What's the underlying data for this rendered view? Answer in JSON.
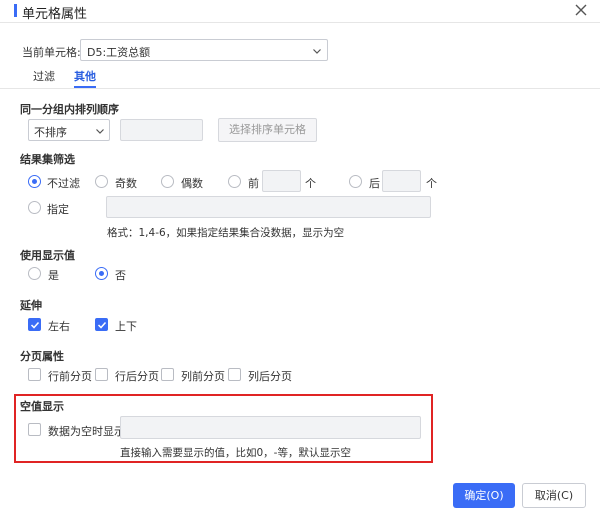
{
  "dialog": {
    "title": "单元格属性",
    "accent_color": "#3a6cf6",
    "close_icon": "close-icon"
  },
  "current_cell": {
    "label": "当前单元格:",
    "value": "D5:工资总额"
  },
  "tabs": [
    {
      "label": "过滤",
      "active": false
    },
    {
      "label": "其他",
      "active": true
    }
  ],
  "group_sort": {
    "title": "同一分组内排列顺序",
    "select_value": "不排序",
    "cell_input_value": "",
    "select_cell_button": "选择排序单元格"
  },
  "result_filter": {
    "title": "结果集筛选",
    "options": {
      "none": "不过滤",
      "odd": "奇数",
      "even": "偶数",
      "front": "前",
      "back": "后",
      "specify": "指定"
    },
    "selected": "none",
    "unit_front": "个",
    "unit_back": "个",
    "front_value": "",
    "back_value": "",
    "specify_value": "",
    "format_hint": "格式：1,4-6，如果指定结果集合没数据，显示为空"
  },
  "use_display_value": {
    "title": "使用显示值",
    "yes": "是",
    "no": "否",
    "selected": "no"
  },
  "extend": {
    "title": "延伸",
    "left_right": "左右",
    "up_down": "上下",
    "left_right_checked": true,
    "up_down_checked": true
  },
  "page_props": {
    "title": "分页属性",
    "row_before": "行前分页",
    "row_after": "行后分页",
    "col_before": "列前分页",
    "col_after": "列后分页"
  },
  "empty_display": {
    "title": "空值显示",
    "checkbox_label": "数据为空时显示",
    "input_value": "",
    "hint": "直接输入需要显示的值，比如0，-等，默认显示空"
  },
  "footer": {
    "ok": "确定(O)",
    "cancel": "取消(C)",
    "primary_color": "#3a6cf6"
  }
}
